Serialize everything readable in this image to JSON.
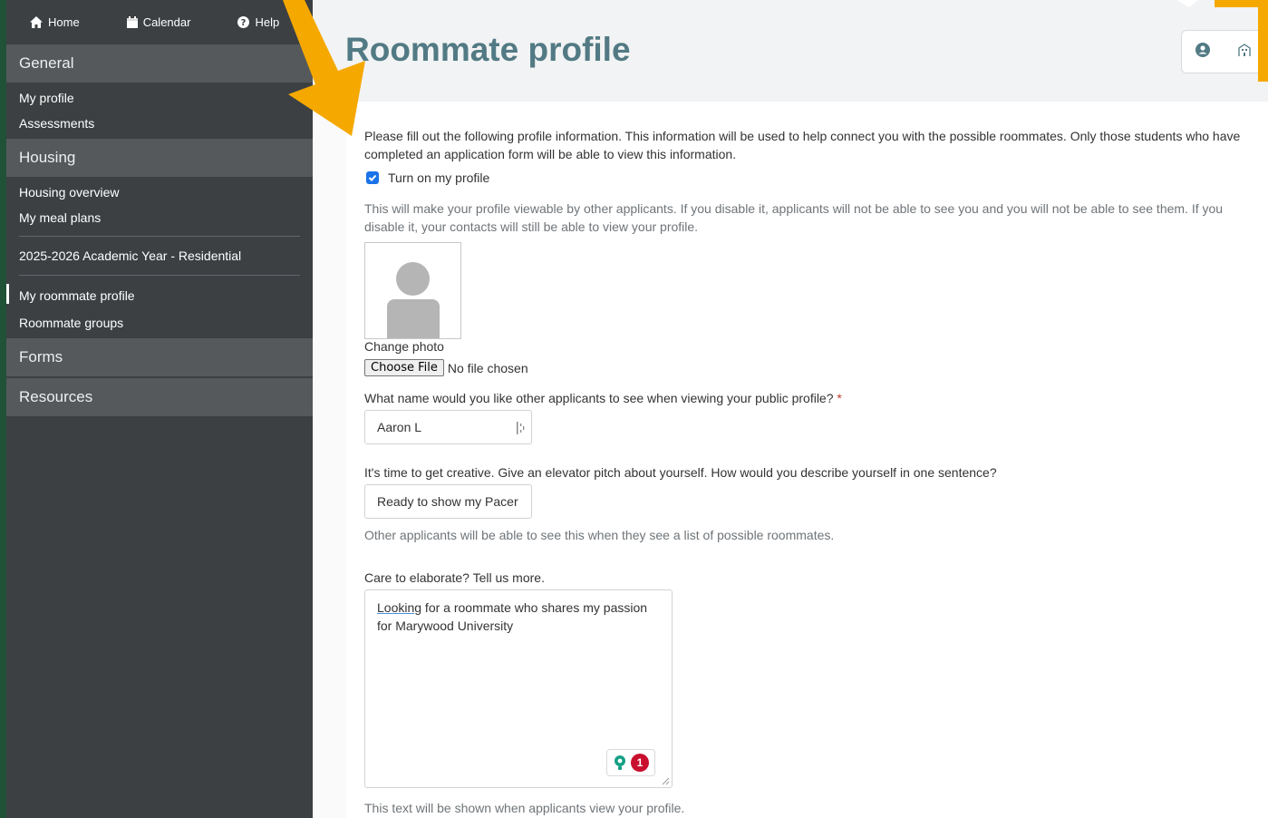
{
  "topnav": {
    "home": "Home",
    "calendar": "Calendar",
    "help": "Help"
  },
  "sidebar": {
    "general": {
      "heading": "General",
      "items": [
        "My profile",
        "Assessments"
      ]
    },
    "housing": {
      "heading": "Housing",
      "items": [
        "Housing overview",
        "My meal plans"
      ],
      "term": "2025-2026 Academic Year - Residential",
      "term_items": [
        "My roommate profile",
        "Roommate groups"
      ]
    },
    "forms": {
      "heading": "Forms"
    },
    "resources": {
      "heading": "Resources"
    }
  },
  "header": {
    "title": "Roommate profile",
    "icons": [
      "user-circle-icon",
      "building-icon"
    ]
  },
  "form": {
    "intro": "Please fill out the following profile information. This information will be used to help connect you with the possible roommates. Only those students who have completed an application form will be able to view this information.",
    "toggle_label": "Turn on my profile",
    "toggle_checked": true,
    "toggle_help": "This will make your profile viewable by other applicants. If you disable it, applicants will not be able to see you and you will not be able to see them. If you disable it, your contacts will still be able to view your profile.",
    "change_photo": "Change photo",
    "file_button": "Choose File",
    "file_status": "No file chosen",
    "name_label": "What name would you like other applicants to see when viewing your public profile?",
    "name_required": "*",
    "name_value": "Aaron L",
    "pitch_label": "It's time to get creative. Give an elevator pitch about yourself. How would you describe yourself in one sentence?",
    "pitch_value": "Ready to show my Pacer",
    "pitch_help": "Other applicants will be able to see this when they see a list of possible roommates.",
    "elaborate_label": "Care to elaborate? Tell us more.",
    "elaborate_first_word": "Looking",
    "elaborate_rest": " for a roommate who shares my passion for Marywood University",
    "grammar_count": "1",
    "elaborate_help": "This text will be shown when applicants view your profile."
  },
  "colors": {
    "frame_green": "#1f5236",
    "sidebar": "#3c4043",
    "section_header": "#55595c",
    "title": "#527a84",
    "arrow": "#f5a800",
    "checkbox": "#1a73e8",
    "badge_red": "#c8102e"
  }
}
